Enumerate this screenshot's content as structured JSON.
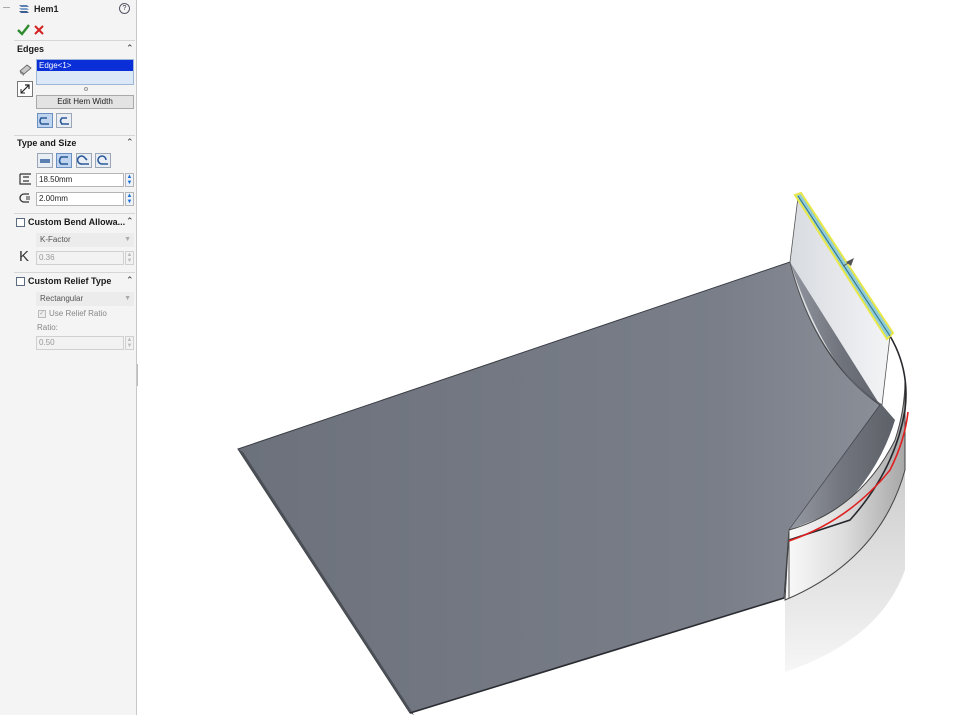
{
  "property_manager": {
    "feature_title": "Hem1",
    "edges_section": {
      "title": "Edges",
      "selected_items": [
        "Edge<1>"
      ],
      "edit_width_button": "Edit Hem Width"
    },
    "type_size_section": {
      "title": "Type and Size",
      "length_value": "18.50mm",
      "gap_value": "2.00mm"
    },
    "bend_allowance_section": {
      "title": "Custom Bend Allowa...",
      "checked": false,
      "type": "K-Factor",
      "k_symbol": "K",
      "k_value": "0.36"
    },
    "relief_section": {
      "title": "Custom Relief Type",
      "checked": false,
      "type": "Rectangular",
      "use_ratio_label": "Use Relief Ratio",
      "ratio_label": "Ratio:",
      "ratio_value": "0.50"
    }
  },
  "colors": {
    "accept": "#2e8b2e",
    "cancel": "#d42020",
    "selection": "#0a2fd8",
    "highlight_edge": "#e8e84a",
    "hem_edge": "#e02020",
    "sheet": "#6f7480"
  }
}
